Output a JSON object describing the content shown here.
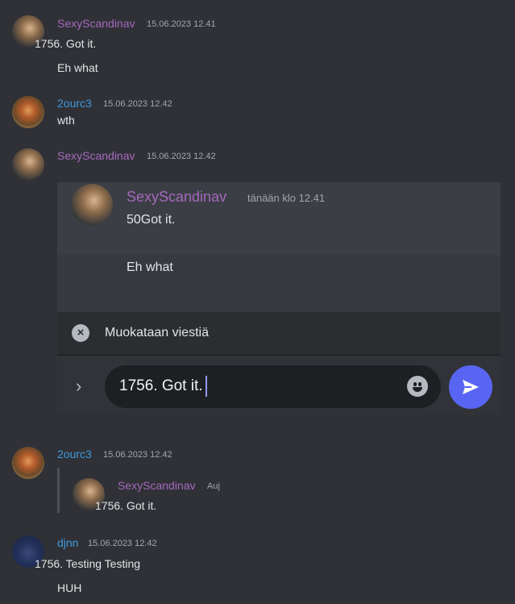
{
  "messages": [
    {
      "author": "SexyScandinav",
      "time": "15.06.2023 12.41",
      "lines": [
        "1756. Got it.",
        "Eh what"
      ]
    },
    {
      "author": "2ourc3",
      "time": "15.06.2023 12.42",
      "lines": [
        "wth"
      ]
    },
    {
      "author": "SexyScandinav",
      "time": "15.06.2023 12.42"
    },
    {
      "author": "2ourc3",
      "time": "15.06.2023 12.42",
      "reply": {
        "author": "SexyScandinav",
        "time": "Auj",
        "text": "1756. Got it."
      }
    },
    {
      "author": "djnn",
      "time": "15.06.2023 12.42",
      "lines": [
        "1756. Testing Testing",
        "HUH"
      ]
    }
  ],
  "edit_panel": {
    "author": "SexyScandinav",
    "time": "tänään klo 12.41",
    "line1": "50Got it.",
    "line2": "Eh what",
    "editing_label": "Muokataan viestiä",
    "input_value": "1756. Got it."
  },
  "colors": {
    "background": "#2f3136",
    "purple_name": "#a569bd",
    "blue_name": "#3f9ae0",
    "send": "#5865f2"
  },
  "icons": [
    "close-circle-icon",
    "chevron-right-icon",
    "emoji-icon",
    "send-icon"
  ]
}
